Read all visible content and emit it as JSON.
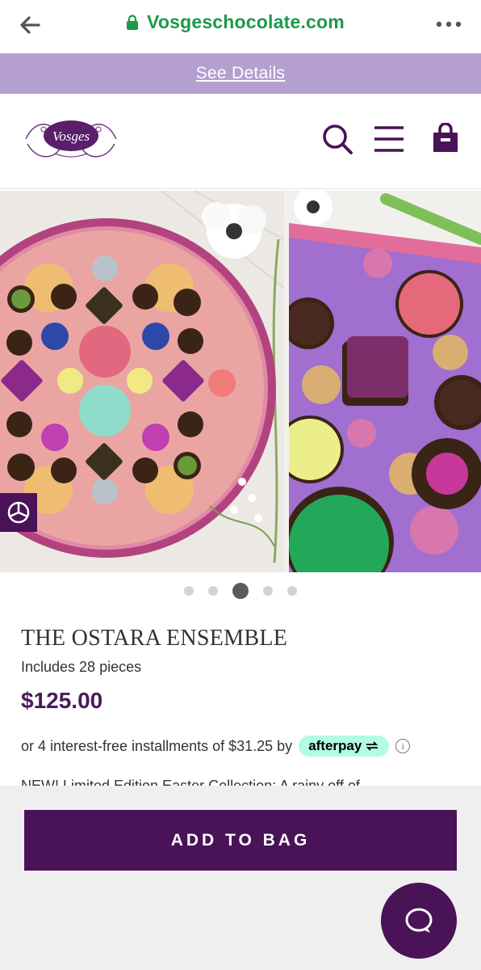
{
  "browser": {
    "url": "Vosgeschocolate.com",
    "icons": [
      "back-arrow-icon",
      "lock-icon",
      "more-dots-icon"
    ]
  },
  "promo": {
    "link_label": "See Details"
  },
  "header": {
    "logo_text": "Vosges",
    "icons": [
      "search-icon",
      "hamburger-menu-icon",
      "shopping-bag-icon"
    ]
  },
  "carousel": {
    "slide_count": 5,
    "active_index": 2
  },
  "product": {
    "title": "THE OSTARA ENSEMBLE",
    "pieces": "Includes 28 pieces",
    "price": "$125.00",
    "afterpay_text": "or 4 interest-free installments of $31.25 by",
    "afterpay_brand": "afterpay",
    "description_partial": "NEW! Limited Edition Easter Collection: A rainy off of..."
  },
  "actions": {
    "add_to_bag": "ADD TO BAG"
  },
  "colors": {
    "brand_purple": "#4a1257",
    "promo_bg": "#b59fcf",
    "url_green": "#1a9a4a",
    "afterpay_mint": "#b2fce4"
  }
}
